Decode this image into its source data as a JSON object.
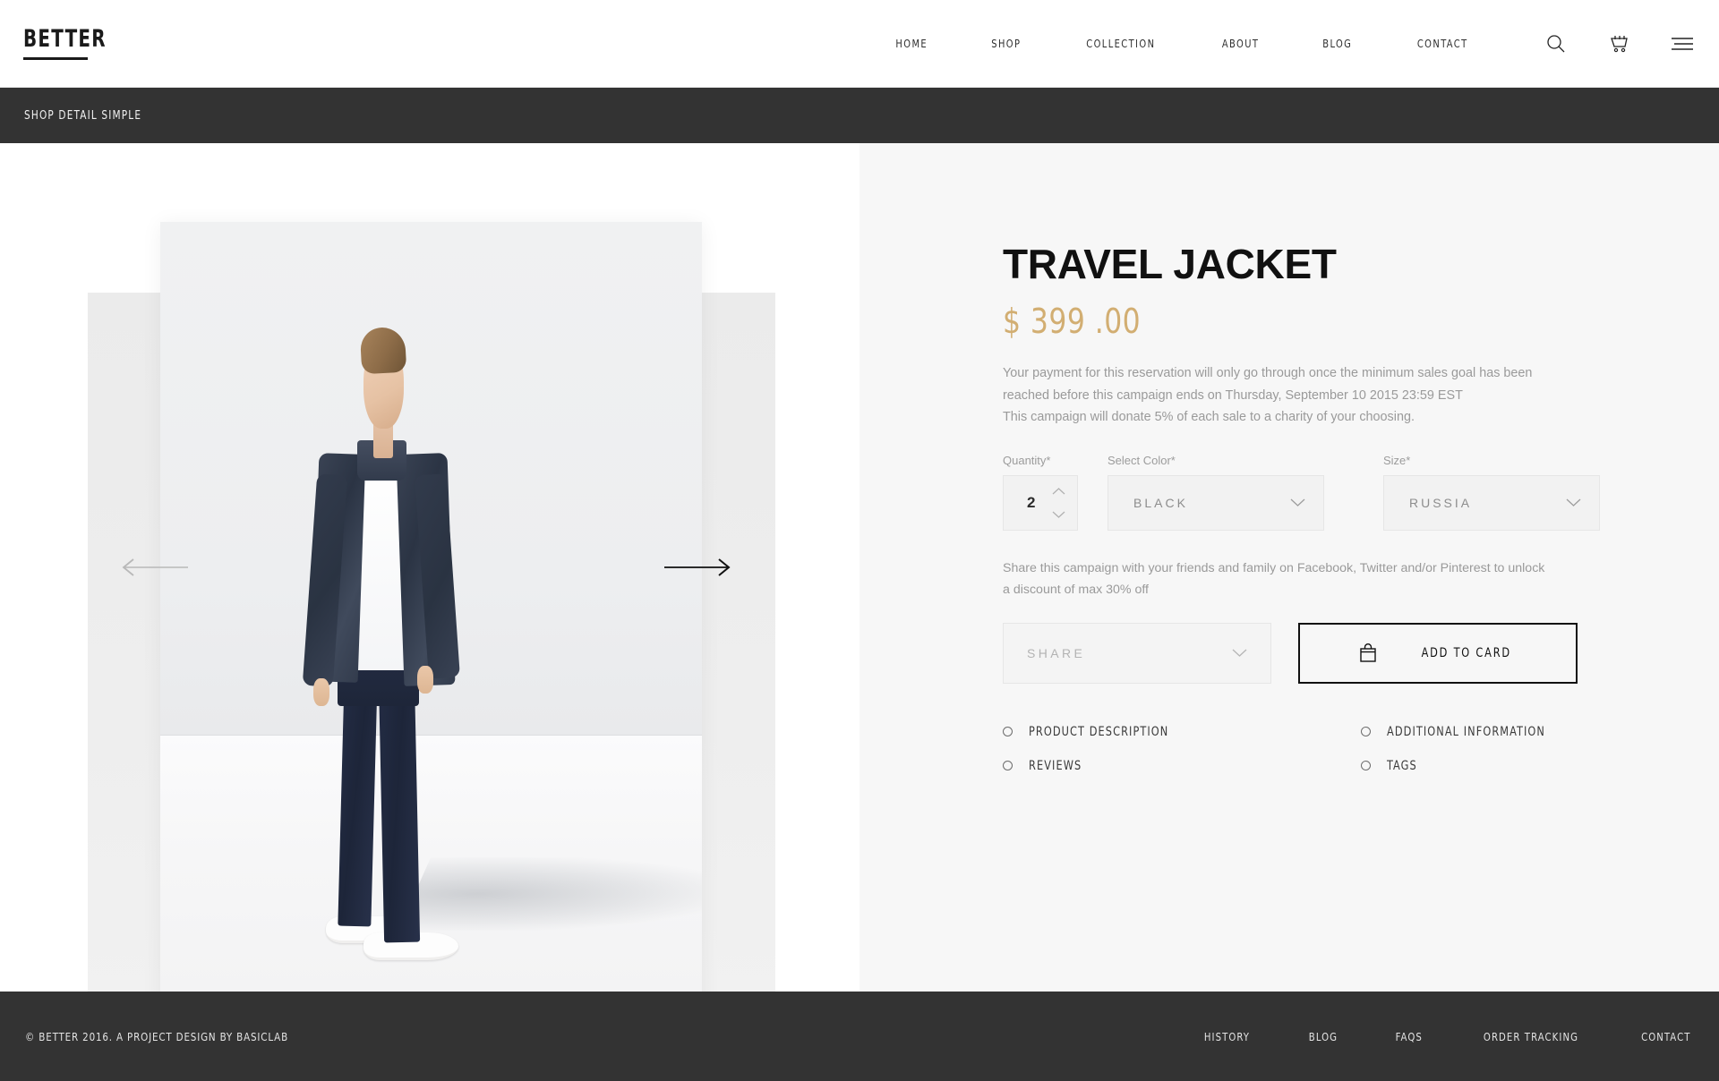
{
  "header": {
    "logo": "BETTER",
    "nav": [
      {
        "label": "HOME"
      },
      {
        "label": "SHOP"
      },
      {
        "label": "COLLECTION"
      },
      {
        "label": "ABOUT"
      },
      {
        "label": "BLOG"
      },
      {
        "label": "CONTACT"
      }
    ],
    "icons": [
      {
        "name": "search-icon"
      },
      {
        "name": "cart-icon"
      },
      {
        "name": "hamburger-menu-icon"
      }
    ]
  },
  "breadcrumb": {
    "title": "SHOP DETAIL SIMPLE"
  },
  "gallery": {
    "prev_label": "previous-image",
    "next_label": "next-image"
  },
  "product": {
    "title": "TRAVEL JACKET",
    "price": "$ 399 .00",
    "description_line1": "Your payment for this reservation will only go through once the minimum sales goal has been",
    "description_line2": "reached before this campaign ends on Thursday, September 10 2015 23:59 EST",
    "description_line3": "This campaign will donate 5% of each sale to a charity of your choosing.",
    "share_note_line1": "Share this campaign with your friends and family on Facebook, Twitter and/or Pinterest to unlock",
    "share_note_line2": "a discount of max 30% off",
    "accent_color": "#d2ae72"
  },
  "form": {
    "quantity": {
      "label": "Quantity*",
      "value": "2"
    },
    "color": {
      "label": "Select Color*",
      "value": "BLACK"
    },
    "size": {
      "label": "Size*",
      "value": "RUSSIA"
    },
    "share": {
      "value": "SHARE"
    },
    "add_to_cart": {
      "label": "ADD TO CARD"
    }
  },
  "accordion": [
    {
      "label": "PRODUCT DESCRIPTION"
    },
    {
      "label": "ADDITIONAL INFORMATION"
    },
    {
      "label": "REVIEWS"
    },
    {
      "label": "TAGS"
    }
  ],
  "footer": {
    "copyright": "© BETTER 2016. A PROJECT DESIGN BY BASICLAB",
    "links": [
      {
        "label": "HISTORY"
      },
      {
        "label": "BLOG"
      },
      {
        "label": "FAQS"
      },
      {
        "label": "ORDER TRACKING"
      },
      {
        "label": "CONTACT"
      }
    ]
  }
}
